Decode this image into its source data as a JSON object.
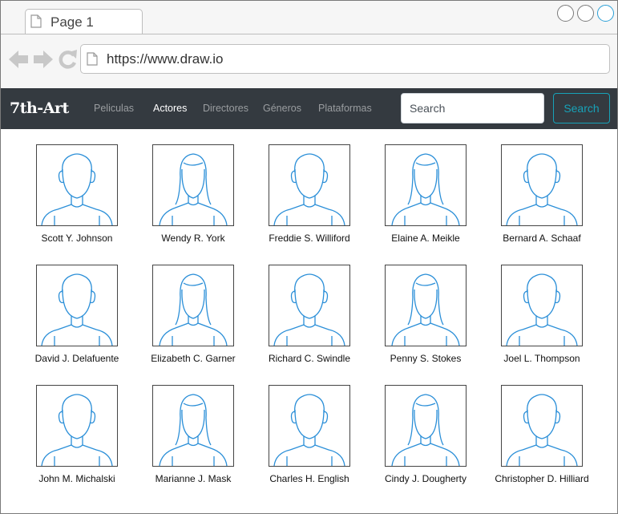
{
  "browser": {
    "tab_title": "Page 1",
    "url": "https://www.draw.io"
  },
  "navbar": {
    "brand": "7th-Art",
    "links": [
      {
        "label": "Peliculas",
        "active": false
      },
      {
        "label": "Actores",
        "active": true
      },
      {
        "label": "Directores",
        "active": false
      },
      {
        "label": "Géneros",
        "active": false
      },
      {
        "label": "Plataformas",
        "active": false
      }
    ],
    "search_placeholder": "Search",
    "search_button": "Search"
  },
  "actors": [
    {
      "name": "Scott Y. Johnson",
      "avatar": "male-avatar-icon"
    },
    {
      "name": "Wendy R. York",
      "avatar": "female-avatar-icon"
    },
    {
      "name": "Freddie S. Williford",
      "avatar": "male-avatar-icon"
    },
    {
      "name": "Elaine A. Meikle",
      "avatar": "female-avatar-icon"
    },
    {
      "name": "Bernard A. Schaaf",
      "avatar": "male-avatar-icon"
    },
    {
      "name": "David J. Delafuente",
      "avatar": "male-avatar-icon"
    },
    {
      "name": "Elizabeth C. Garner",
      "avatar": "female-avatar-icon"
    },
    {
      "name": "Richard C. Swindle",
      "avatar": "male-avatar-icon"
    },
    {
      "name": "Penny S. Stokes",
      "avatar": "female-avatar-icon"
    },
    {
      "name": "Joel L. Thompson",
      "avatar": "male-avatar-icon"
    },
    {
      "name": "John M. Michalski",
      "avatar": "male-avatar-icon"
    },
    {
      "name": "Marianne J. Mask",
      "avatar": "female-avatar-icon"
    },
    {
      "name": "Charles H. English",
      "avatar": "male-avatar-icon"
    },
    {
      "name": "Cindy J. Dougherty",
      "avatar": "female-avatar-icon"
    },
    {
      "name": "Christopher D. Hilliard",
      "avatar": "male-avatar-icon"
    }
  ],
  "colors": {
    "navbar_bg": "#343a40",
    "accent": "#17a2b8",
    "avatar_line": "#2b8fd8"
  }
}
